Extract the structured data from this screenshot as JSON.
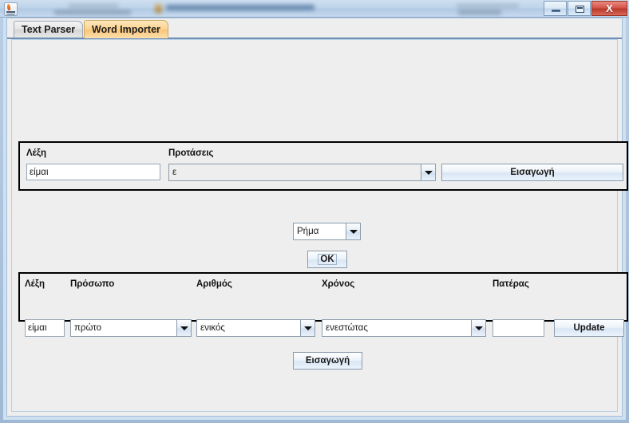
{
  "window": {
    "app_icon": "java-coffee-cup-icon",
    "controls": {
      "minimize": "minimize-icon",
      "restore": "restore-icon",
      "close": "X"
    }
  },
  "tabs": [
    {
      "label": "Text Parser",
      "active": false
    },
    {
      "label": "Word Importer",
      "active": true
    }
  ],
  "word_panel": {
    "word_label": "Λέξη",
    "word_value": "είμαι",
    "sentences_label": "Προτάσεις",
    "sentences_value": "ε",
    "insert_button": "Εισαγωγή"
  },
  "type_selector": {
    "value": "Ρήμα",
    "ok_button": "OK"
  },
  "attributes_panel": {
    "word_label": "Λέξη",
    "word_value": "είμαι",
    "person_label": "Πρόσωπο",
    "person_value": "πρώτο",
    "number_label": "Αριθμός",
    "number_value": "ενικός",
    "tense_label": "Χρόνος",
    "tense_value": "ενεστώτας",
    "parent_label": "Πατέρας",
    "parent_value": "",
    "update_button": "Update"
  },
  "footer": {
    "insert_button": "Εισαγωγή"
  },
  "colors": {
    "active_tab": "#f9c477",
    "inactive_tab": "#e3e3e3",
    "panel_border": "#000000",
    "content_bg": "#eeeeee",
    "frame": "#b8cee4",
    "close_button": "#b93a2c"
  }
}
